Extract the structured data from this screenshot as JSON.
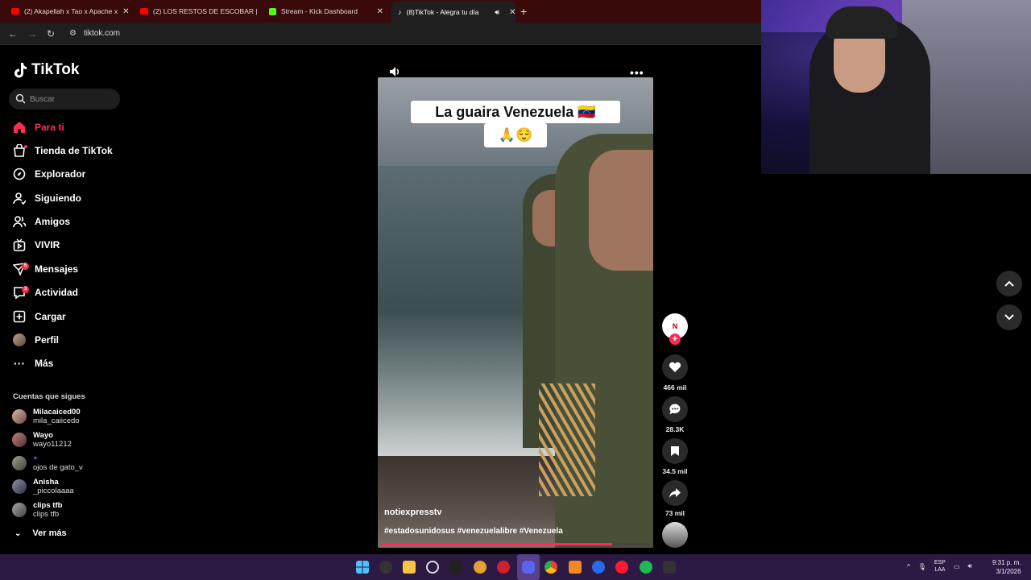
{
  "browser": {
    "tabs": [
      {
        "title": "(2) Akapellah x Tao x Apache x",
        "favicon_color": "#ff0000"
      },
      {
        "title": "(2) LOS RESTOS DE ESCOBAR |",
        "favicon_color": "#ff0000"
      },
      {
        "title": "Stream - Kick Dashboard",
        "favicon_color": "#53fc18"
      },
      {
        "title": "(8)TikTok - Alegra tu día",
        "favicon_color": "#ffffff"
      }
    ],
    "new_tab_symbol": "+",
    "url": "tiktok.com"
  },
  "tiktok": {
    "brand": "TikTok",
    "search_placeholder": "Buscar",
    "nav": [
      {
        "label": "Para ti",
        "icon": "home-icon",
        "active": true
      },
      {
        "label": "Tienda de TikTok",
        "icon": "shop-icon"
      },
      {
        "label": "Explorador",
        "icon": "compass-icon"
      },
      {
        "label": "Siguiendo",
        "icon": "following-icon"
      },
      {
        "label": "Amigos",
        "icon": "friends-icon"
      },
      {
        "label": "VIVIR",
        "icon": "live-icon"
      },
      {
        "label": "Mensajes",
        "icon": "messages-icon",
        "badge": "5"
      },
      {
        "label": "Actividad",
        "icon": "activity-icon",
        "badge": "3"
      },
      {
        "label": "Cargar",
        "icon": "upload-icon"
      },
      {
        "label": "Perfil",
        "icon": "profile-avatar"
      },
      {
        "label": "Más",
        "icon": "more-icon"
      }
    ],
    "following_title": "Cuentas que sigues",
    "following": [
      {
        "name": "Milacaiced00",
        "handle": "mila_caiicedo"
      },
      {
        "name": "Wayo",
        "handle": "wayo11212"
      },
      {
        "name": "",
        "handle": "ojos de gato_v"
      },
      {
        "name": "Anisha",
        "handle": "_piccolaaaa"
      },
      {
        "name": "clips tfb",
        "handle": "clips tfb"
      }
    ],
    "see_more": "Ver más"
  },
  "video": {
    "caption_line1": "La guaira Venezuela 🇻🇪",
    "caption_line2": "🙏😌",
    "author": "notiexpresstv",
    "hashtags": "#estadosunidosus #venezuelalibre #Venezuela",
    "progress": 0.86,
    "creator_avatar_text": "N",
    "likes": "466 mil",
    "comments": "28.3K",
    "saves": "34.5 mil",
    "shares": "73 mil"
  },
  "taskbar": {
    "lang": "ESP",
    "lang_sub": "LAA",
    "time": "9:31 p. m.",
    "date": "3/1/2026"
  },
  "colors": {
    "accent": "#fe2c55",
    "tabbar": "#3a0a0a",
    "taskbar": "#2c1a44"
  }
}
